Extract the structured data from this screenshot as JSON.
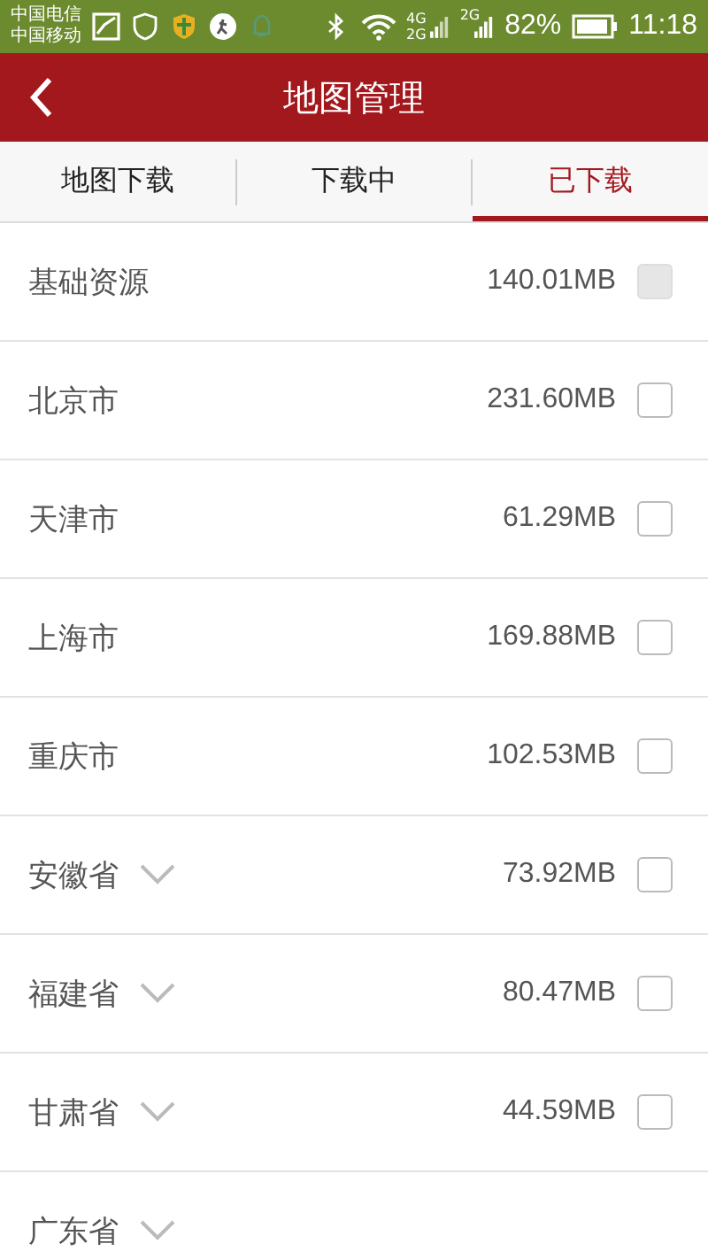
{
  "status_bar": {
    "carriers": [
      "中国电信",
      "中国移动"
    ],
    "network_labels": [
      "4G",
      "2G",
      "2G"
    ],
    "battery_text": "82%",
    "time": "11:18"
  },
  "header": {
    "title": "地图管理"
  },
  "tabs": [
    {
      "label": "地图下载",
      "selected": false
    },
    {
      "label": "下载中",
      "selected": false
    },
    {
      "label": "已下载",
      "selected": true
    }
  ],
  "rows": [
    {
      "name": "基础资源",
      "size": "140.01MB",
      "expandable": false,
      "disabled": true,
      "checked": false
    },
    {
      "name": "北京市",
      "size": "231.60MB",
      "expandable": false,
      "disabled": false,
      "checked": false
    },
    {
      "name": "天津市",
      "size": "61.29MB",
      "expandable": false,
      "disabled": false,
      "checked": false
    },
    {
      "name": "上海市",
      "size": "169.88MB",
      "expandable": false,
      "disabled": false,
      "checked": false
    },
    {
      "name": "重庆市",
      "size": "102.53MB",
      "expandable": false,
      "disabled": false,
      "checked": false
    },
    {
      "name": "安徽省",
      "size": "73.92MB",
      "expandable": true,
      "disabled": false,
      "checked": false
    },
    {
      "name": "福建省",
      "size": "80.47MB",
      "expandable": true,
      "disabled": false,
      "checked": false
    },
    {
      "name": "甘肃省",
      "size": "44.59MB",
      "expandable": true,
      "disabled": false,
      "checked": false
    },
    {
      "name": "广东省",
      "expandable": true
    }
  ]
}
